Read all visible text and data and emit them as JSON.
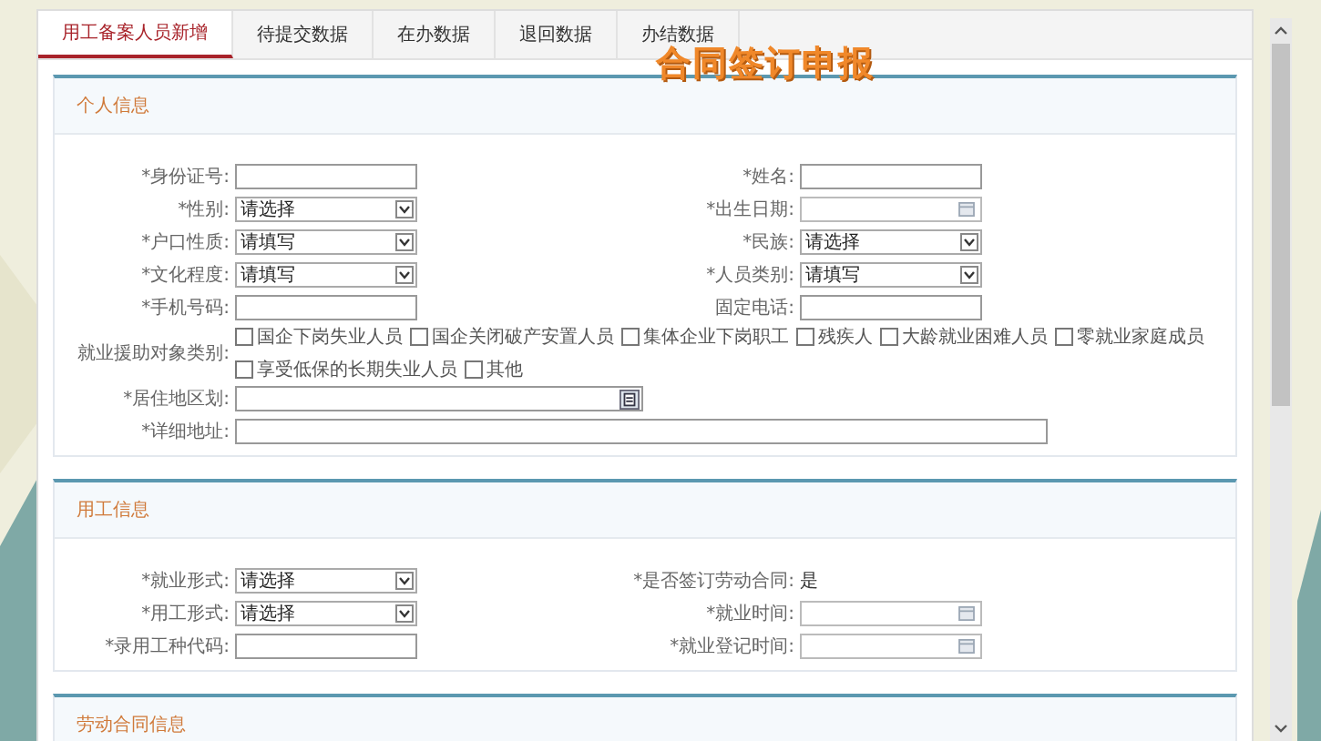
{
  "tabs": [
    {
      "label": "用工备案人员新增",
      "selected": true
    },
    {
      "label": "待提交数据",
      "selected": false
    },
    {
      "label": "在办数据",
      "selected": false
    },
    {
      "label": "退回数据",
      "selected": false
    },
    {
      "label": "办结数据",
      "selected": false
    }
  ],
  "overlay_title": "合同签订申报",
  "sections": [
    {
      "title": "个人信息",
      "rows": [
        [
          {
            "label": "*身份证号:",
            "kind": "text"
          },
          {
            "label": "*姓名:",
            "kind": "text"
          }
        ],
        [
          {
            "label": "*性别:",
            "kind": "select",
            "value": "请选择"
          },
          {
            "label": "*出生日期:",
            "kind": "date"
          }
        ],
        [
          {
            "label": "*户口性质:",
            "kind": "select",
            "value": "请填写"
          },
          {
            "label": "*民族:",
            "kind": "select",
            "value": "请选择"
          }
        ],
        [
          {
            "label": "*文化程度:",
            "kind": "select",
            "value": "请填写"
          },
          {
            "label": "*人员类别:",
            "kind": "select",
            "value": "请填写"
          }
        ],
        [
          {
            "label": "*手机号码:",
            "kind": "text"
          },
          {
            "label": "固定电话:",
            "kind": "text"
          }
        ],
        [
          {
            "label": "就业援助对象类别:",
            "kind": "checkboxes",
            "options": [
              {
                "label": "国企下岗失业人员",
                "checked": false
              },
              {
                "label": "国企关闭破产安置人员",
                "checked": false
              },
              {
                "label": "集体企业下岗职工",
                "checked": false
              },
              {
                "label": "残疾人",
                "checked": false
              },
              {
                "label": "大龄就业困难人员",
                "checked": false
              },
              {
                "label": "零就业家庭成员",
                "checked": false
              },
              {
                "label": "享受低保的长期失业人员",
                "checked": false
              },
              {
                "label": "其他",
                "checked": false
              }
            ]
          }
        ],
        [
          {
            "label": "*居住地区划:",
            "kind": "region"
          }
        ],
        [
          {
            "label": "*详细地址:",
            "kind": "address"
          }
        ]
      ]
    },
    {
      "title": "用工信息",
      "rows": [
        [
          {
            "label": "*就业形式:",
            "kind": "select",
            "value": "请选择"
          },
          {
            "label": "*是否签订劳动合同:",
            "kind": "static",
            "value": "是"
          }
        ],
        [
          {
            "label": "*用工形式:",
            "kind": "select",
            "value": "请选择"
          },
          {
            "label": "*就业时间:",
            "kind": "date"
          }
        ],
        [
          {
            "label": "*录用工种代码:",
            "kind": "text"
          },
          {
            "label": "*就业登记时间:",
            "kind": "date"
          }
        ]
      ]
    },
    {
      "title": "劳动合同信息"
    }
  ]
}
